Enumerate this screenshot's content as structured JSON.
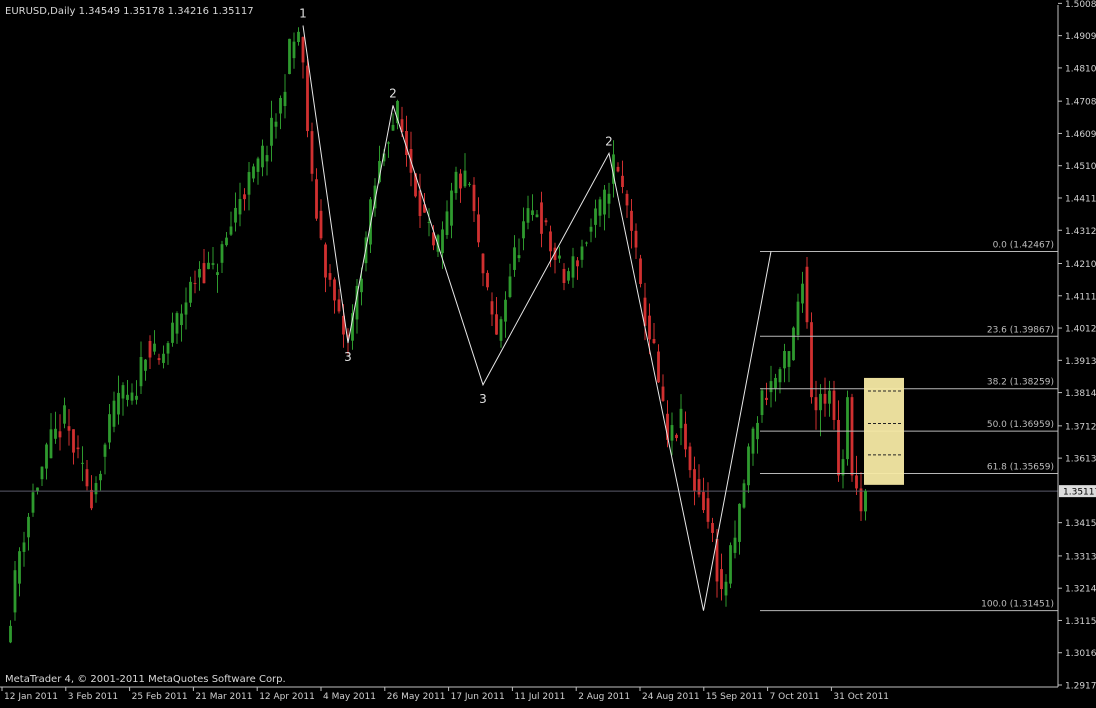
{
  "window": {
    "header": "EURUSD,Daily  1.34549 1.35178 1.34216 1.35117",
    "copyright": "MetaTrader 4, © 2001-2011 MetaQuotes Software Corp.",
    "current_price_label": "1.35117"
  },
  "colors": {
    "background": "#000000",
    "axis": "#c0c0c0",
    "bull": "#2e9a2e",
    "bear": "#d03030",
    "zigzag": "#e8e8e8",
    "fib": "#b8b8b8",
    "zone": "#f5e9a4",
    "price_line": "#5a5a6a"
  },
  "chart_data": {
    "type": "candlestick",
    "symbol": "EURUSD",
    "timeframe": "Daily",
    "ylim": [
      1.2917,
      1.5003
    ],
    "yticks": [
      "1.50080",
      "1.49090",
      "1.48100",
      "1.47080",
      "1.46090",
      "1.45100",
      "1.44110",
      "1.43120",
      "1.42100",
      "1.41110",
      "1.40120",
      "1.39130",
      "1.38140",
      "1.37120",
      "1.36130",
      "1.35117",
      "1.34150",
      "1.33130",
      "1.32140",
      "1.31150",
      "1.30160",
      "1.29170"
    ],
    "xticks": [
      "12 Jan 2011",
      "3 Feb 2011",
      "25 Feb 2011",
      "21 Mar 2011",
      "12 Apr 2011",
      "4 May 2011",
      "26 May 2011",
      "17 Jun 2011",
      "11 Jul 2011",
      "2 Aug 2011",
      "24 Aug 2011",
      "15 Sep 2011",
      "7 Oct 2011",
      "31 Oct 2011"
    ],
    "current_price": 1.35117,
    "close_path": [
      [
        0,
        1.305
      ],
      [
        3,
        1.333
      ],
      [
        6,
        1.35
      ],
      [
        10,
        1.366
      ],
      [
        13,
        1.373
      ],
      [
        16,
        1.36
      ],
      [
        19,
        1.35
      ],
      [
        22,
        1.365
      ],
      [
        25,
        1.381
      ],
      [
        28,
        1.378
      ],
      [
        31,
        1.396
      ],
      [
        34,
        1.39
      ],
      [
        37,
        1.4
      ],
      [
        40,
        1.41
      ],
      [
        43,
        1.42
      ],
      [
        46,
        1.418
      ],
      [
        49,
        1.428
      ],
      [
        52,
        1.442
      ],
      [
        55,
        1.448
      ],
      [
        58,
        1.457
      ],
      [
        61,
        1.47
      ],
      [
        63,
        1.486
      ],
      [
        65,
        1.492
      ],
      [
        66,
        1.48
      ],
      [
        68,
        1.445
      ],
      [
        71,
        1.42
      ],
      [
        74,
        1.403
      ],
      [
        76,
        1.397
      ],
      [
        79,
        1.42
      ],
      [
        82,
        1.445
      ],
      [
        85,
        1.462
      ],
      [
        87,
        1.467
      ],
      [
        89,
        1.455
      ],
      [
        92,
        1.44
      ],
      [
        95,
        1.424
      ],
      [
        97,
        1.428
      ],
      [
        100,
        1.447
      ],
      [
        103,
        1.445
      ],
      [
        105,
        1.425
      ],
      [
        107,
        1.41
      ],
      [
        109,
        1.398
      ],
      [
        112,
        1.418
      ],
      [
        115,
        1.432
      ],
      [
        118,
        1.438
      ],
      [
        121,
        1.426
      ],
      [
        124,
        1.416
      ],
      [
        127,
        1.423
      ],
      [
        130,
        1.432
      ],
      [
        133,
        1.44
      ],
      [
        135,
        1.452
      ],
      [
        137,
        1.443
      ],
      [
        139,
        1.433
      ],
      [
        141,
        1.411
      ],
      [
        144,
        1.393
      ],
      [
        147,
        1.366
      ],
      [
        150,
        1.372
      ],
      [
        152,
        1.356
      ],
      [
        155,
        1.348
      ],
      [
        157,
        1.336
      ],
      [
        159,
        1.319
      ],
      [
        162,
        1.336
      ],
      [
        165,
        1.363
      ],
      [
        168,
        1.38
      ],
      [
        171,
        1.386
      ],
      [
        174,
        1.392
      ],
      [
        177,
        1.415
      ],
      [
        178,
        1.42
      ],
      [
        179,
        1.398
      ],
      [
        181,
        1.376
      ],
      [
        183,
        1.377
      ],
      [
        185,
        1.383
      ],
      [
        187,
        1.369
      ],
      [
        189,
        1.357
      ],
      [
        190,
        1.352
      ],
      [
        192,
        1.347
      ],
      [
        193,
        1.351
      ]
    ],
    "zigzag": [
      {
        "x": 66,
        "y": 1.494,
        "label": "1"
      },
      {
        "x": 76,
        "y": 1.3966,
        "label": "3"
      },
      {
        "x": 86,
        "y": 1.4695,
        "label": "2"
      },
      {
        "x": 106,
        "y": 1.3838,
        "label": "3"
      },
      {
        "x": 134,
        "y": 1.4548,
        "label": "2"
      },
      {
        "x": 155,
        "y": 1.3145,
        "label": ""
      },
      {
        "x": 170,
        "y": 1.4247,
        "label": ""
      }
    ],
    "fibonacci": [
      {
        "label": "0.0 (1.42467)",
        "value": 1.42467
      },
      {
        "label": "23.6 (1.39867)",
        "value": 1.39867
      },
      {
        "label": "38.2 (1.38259)",
        "value": 1.38259
      },
      {
        "label": "50.0 (1.36959)",
        "value": 1.36959
      },
      {
        "label": "61.8 (1.35659)",
        "value": 1.35659
      },
      {
        "label": "100.0 (1.31451)",
        "value": 1.31451
      }
    ],
    "zone": {
      "y_top": 1.3859,
      "y_bottom": 1.3531,
      "dashed_levels": [
        1.3819,
        1.3719,
        1.3623
      ]
    },
    "recent_candles": [
      {
        "x": 178,
        "o": 1.42,
        "h": 1.423,
        "l": 1.401,
        "c": 1.403
      },
      {
        "x": 179,
        "o": 1.403,
        "h": 1.406,
        "l": 1.378,
        "c": 1.38
      },
      {
        "x": 180,
        "o": 1.38,
        "h": 1.385,
        "l": 1.37,
        "c": 1.376
      },
      {
        "x": 181,
        "o": 1.376,
        "h": 1.384,
        "l": 1.368,
        "c": 1.381
      },
      {
        "x": 182,
        "o": 1.381,
        "h": 1.386,
        "l": 1.374,
        "c": 1.378
      },
      {
        "x": 183,
        "o": 1.378,
        "h": 1.385,
        "l": 1.374,
        "c": 1.382
      },
      {
        "x": 184,
        "o": 1.382,
        "h": 1.385,
        "l": 1.37,
        "c": 1.373
      },
      {
        "x": 185,
        "o": 1.373,
        "h": 1.379,
        "l": 1.354,
        "c": 1.356
      },
      {
        "x": 186,
        "o": 1.356,
        "h": 1.364,
        "l": 1.352,
        "c": 1.361
      },
      {
        "x": 187,
        "o": 1.361,
        "h": 1.382,
        "l": 1.359,
        "c": 1.38
      },
      {
        "x": 188,
        "o": 1.38,
        "h": 1.381,
        "l": 1.354,
        "c": 1.356
      },
      {
        "x": 189,
        "o": 1.356,
        "h": 1.362,
        "l": 1.35,
        "c": 1.352
      },
      {
        "x": 190,
        "o": 1.352,
        "h": 1.357,
        "l": 1.342,
        "c": 1.345
      },
      {
        "x": 191,
        "o": 1.345,
        "h": 1.3518,
        "l": 1.3422,
        "c": 1.3512
      }
    ]
  }
}
